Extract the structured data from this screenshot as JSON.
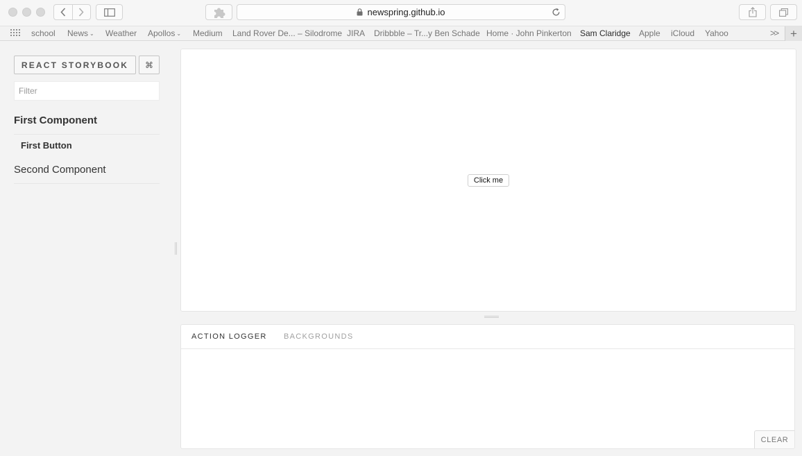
{
  "browser": {
    "url": "newspring.github.io"
  },
  "bookmarks": {
    "items": [
      {
        "label": "school"
      },
      {
        "label": "News",
        "chevron": "⌄"
      },
      {
        "label": "Weather"
      },
      {
        "label": "Apollos",
        "chevron": "⌄"
      },
      {
        "label": "Medium"
      },
      {
        "label": "Land Rover De... – Silodrome"
      },
      {
        "label": "JIRA"
      },
      {
        "label": "Dribbble – Tr...y Ben Schade"
      },
      {
        "label": "Home · John Pinkerton"
      },
      {
        "label": "Sam Claridge"
      },
      {
        "label": "Apple"
      },
      {
        "label": "iCloud"
      },
      {
        "label": "Yahoo"
      }
    ],
    "more_label": ">>",
    "add_label": "+"
  },
  "storybook": {
    "title": "REACT STORYBOOK",
    "shortcut_label": "⌘",
    "filter_placeholder": "Filter",
    "kinds": [
      {
        "name": "First Component",
        "stories": [
          "First Button"
        ]
      },
      {
        "name": "Second Component",
        "stories": []
      }
    ]
  },
  "preview": {
    "button_label": "Click me"
  },
  "addons": {
    "tabs": [
      "ACTION LOGGER",
      "BACKGROUNDS"
    ],
    "clear_label": "CLEAR"
  },
  "colors": {
    "chrome_bg": "#f6f6f6",
    "page_bg": "#f3f3f3",
    "panel_bg": "#ffffff",
    "border": "#e5e5e5",
    "text_primary": "#333333",
    "text_muted": "#a0a0a0"
  }
}
